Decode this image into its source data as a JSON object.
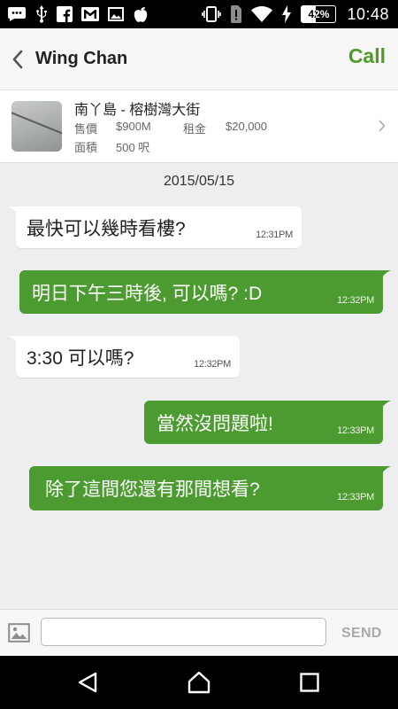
{
  "status_bar": {
    "battery_text": "42%",
    "battery_level": 0.42,
    "time": "10:48",
    "icons": [
      "chat-bubble-icon",
      "usb-icon",
      "facebook-icon",
      "gmail-icon",
      "image-icon",
      "apple-icon",
      "vibrate-icon",
      "alert-icon",
      "wifi-icon",
      "charging-icon",
      "battery-icon"
    ]
  },
  "header": {
    "contact_name": "Wing Chan",
    "call_label": "Call"
  },
  "listing": {
    "title": "南丫島 - 榕樹灣大街",
    "sale_label": "售價",
    "sale_value": "$900M",
    "rent_label": "租金",
    "rent_value": "$20,000",
    "area_label": "面積",
    "area_value": "500 呎"
  },
  "chat": {
    "date": "2015/05/15",
    "messages": [
      {
        "direction": "in",
        "text": "最快可以幾時看樓?",
        "time": "12:31PM"
      },
      {
        "direction": "out",
        "text": "明日下午三時後, 可以嗎? :D",
        "time": "12:32PM"
      },
      {
        "direction": "in",
        "text": "3:30 可以嗎?",
        "time": "12:32PM"
      },
      {
        "direction": "out",
        "text": "當然沒問題啦!",
        "time": "12:33PM"
      },
      {
        "direction": "out",
        "text": "除了這間您還有那間想看?",
        "time": "12:33PM"
      }
    ]
  },
  "composer": {
    "input_value": "",
    "input_placeholder": "",
    "send_label": "SEND"
  },
  "colors": {
    "accent_green": "#4b9b30",
    "call_green": "#4d9a2a",
    "chat_background": "#eeeef1"
  }
}
